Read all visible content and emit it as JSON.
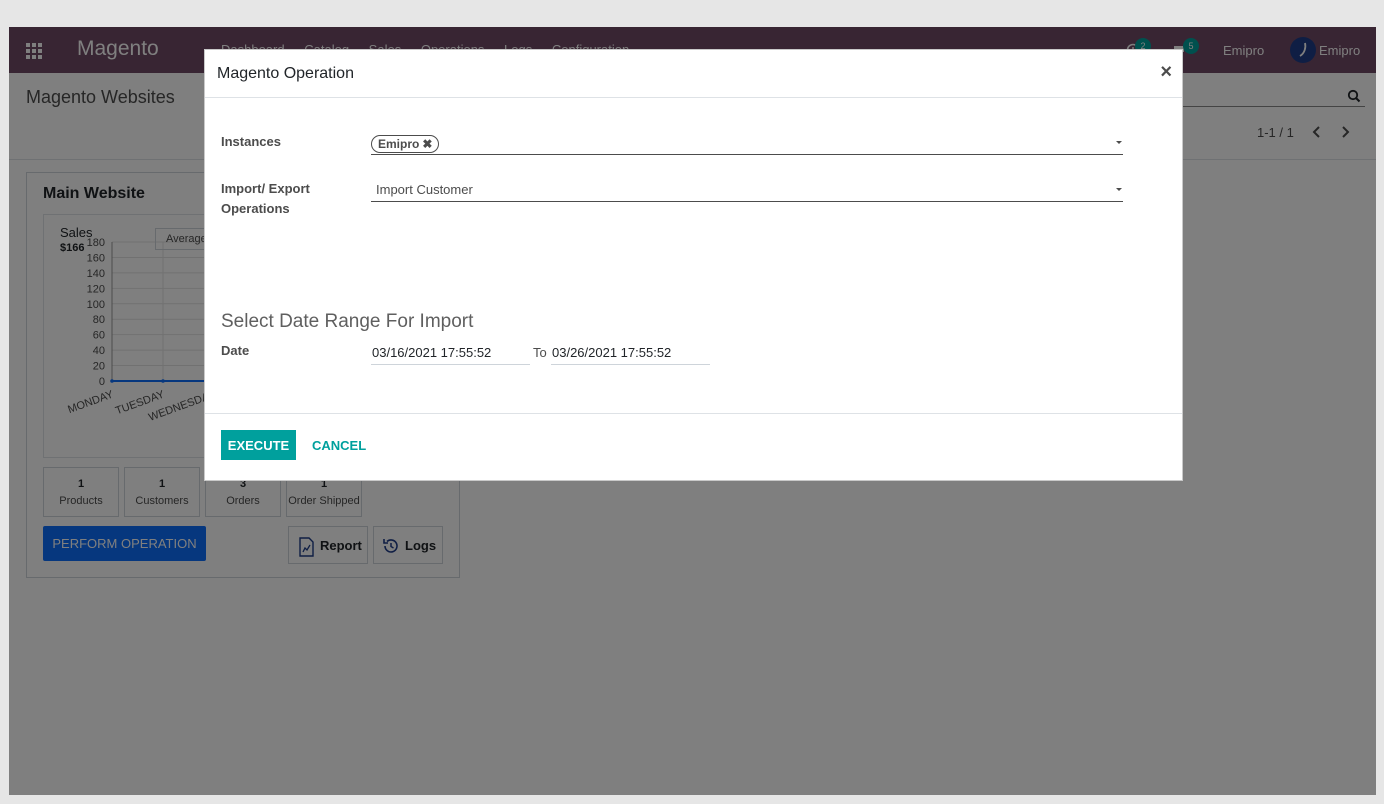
{
  "navbar": {
    "brand": "Magento",
    "menu": [
      "Dashboard",
      "Catalog",
      "Sales",
      "Operations",
      "Logs",
      "Configuration"
    ],
    "activity_count": "2",
    "messages_count": "5",
    "company": "Emipro",
    "user": "Emipro",
    "color": "#714b67"
  },
  "control_panel": {
    "breadcrumb": "Magento Websites",
    "pager": "1-1 / 1"
  },
  "card": {
    "title": "Main Website",
    "graph": {
      "label": "Sales",
      "value": "$166",
      "period": "Average"
    },
    "stats": [
      {
        "value": "1",
        "label": "Products"
      },
      {
        "value": "1",
        "label": "Customers"
      },
      {
        "value": "3",
        "label": "Orders"
      },
      {
        "value": "1",
        "label": "Order Shipped"
      }
    ],
    "perform_label": "PERFORM OPERATION",
    "report_label": "Report",
    "logs_label": "Logs"
  },
  "chart_data": {
    "type": "line",
    "categories": [
      "MONDAY",
      "TUESDAY",
      "WEDNESDAY"
    ],
    "series": [
      {
        "values": [
          0,
          0,
          0
        ]
      }
    ],
    "yticks": [
      "180",
      "160",
      "140",
      "120",
      "100",
      "80",
      "60",
      "40",
      "20",
      "0"
    ],
    "ylim": [
      0,
      180
    ],
    "grid": true,
    "color": "#0d6efd"
  },
  "modal": {
    "title": "Magento Operation",
    "close_label": "×",
    "instances_label": "Instances",
    "instance_tag": "Emipro",
    "operations_label_line1": "Import/ Export",
    "operations_label_line2": "Operations",
    "operation_value": "Import Customer",
    "section_title": "Select Date Range For Import",
    "date_label": "Date",
    "date_from": "03/16/2021 17:55:52",
    "to_label": "To",
    "date_to": "03/26/2021 17:55:52",
    "execute_label": "EXECUTE",
    "cancel_label": "CANCEL",
    "accent_color": "#00a09d"
  }
}
